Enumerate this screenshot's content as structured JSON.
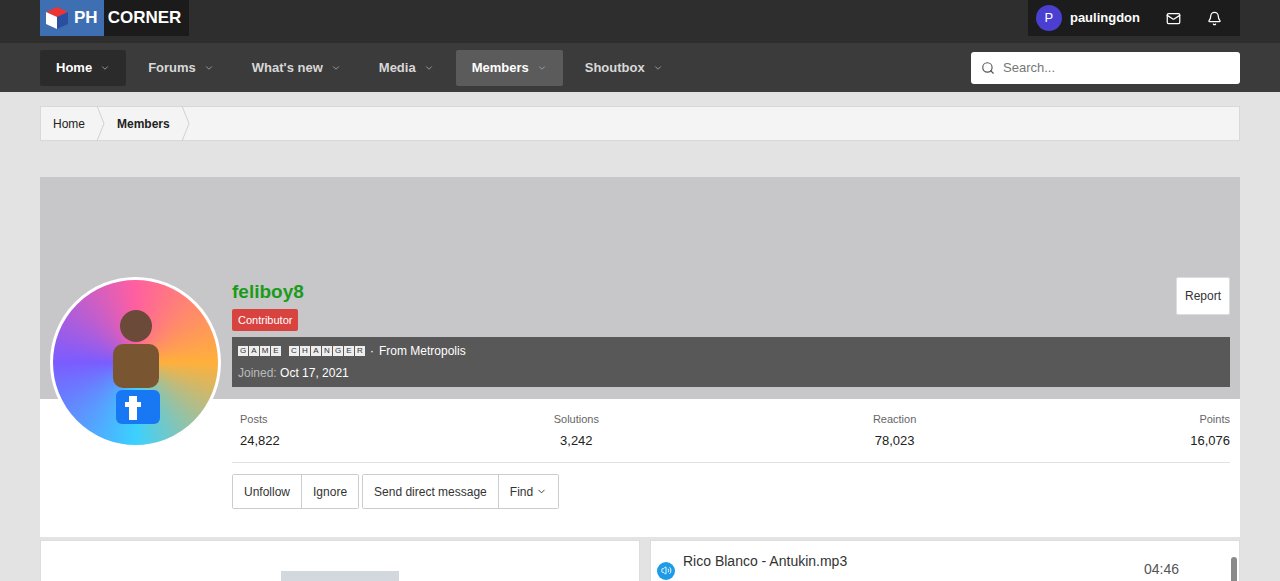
{
  "logo": {
    "left": "PH",
    "right": "CORNER"
  },
  "user": {
    "initial": "P",
    "name": "paulingdon"
  },
  "nav": [
    {
      "label": "Home",
      "selected": false,
      "highlighted": true
    },
    {
      "label": "Forums",
      "selected": false,
      "highlighted": false
    },
    {
      "label": "What's new",
      "selected": false,
      "highlighted": false
    },
    {
      "label": "Media",
      "selected": false,
      "highlighted": false
    },
    {
      "label": "Members",
      "selected": true,
      "highlighted": false
    },
    {
      "label": "Shoutbox",
      "selected": false,
      "highlighted": false
    }
  ],
  "search": {
    "placeholder": "Search..."
  },
  "breadcrumb": [
    {
      "label": "Home",
      "current": false
    },
    {
      "label": "Members",
      "current": true
    }
  ],
  "profile": {
    "username": "feliboy8",
    "badge": "Contributor",
    "title": "GAME CHANGER",
    "separator": "·",
    "location": "From Metropolis",
    "joined_label": "Joined:",
    "joined": "Oct 17, 2021",
    "report": "Report"
  },
  "stats": [
    {
      "label": "Posts",
      "value": "24,822"
    },
    {
      "label": "Solutions",
      "value": "3,242"
    },
    {
      "label": "Reaction",
      "value": "78,023"
    },
    {
      "label": "Points",
      "value": "16,076"
    }
  ],
  "actions": [
    [
      "Unfollow",
      "Ignore"
    ],
    [
      "Send direct message",
      "Find"
    ]
  ],
  "player": {
    "track": "Rico Blanco - Antukin.mp3",
    "duration": "04:46"
  }
}
